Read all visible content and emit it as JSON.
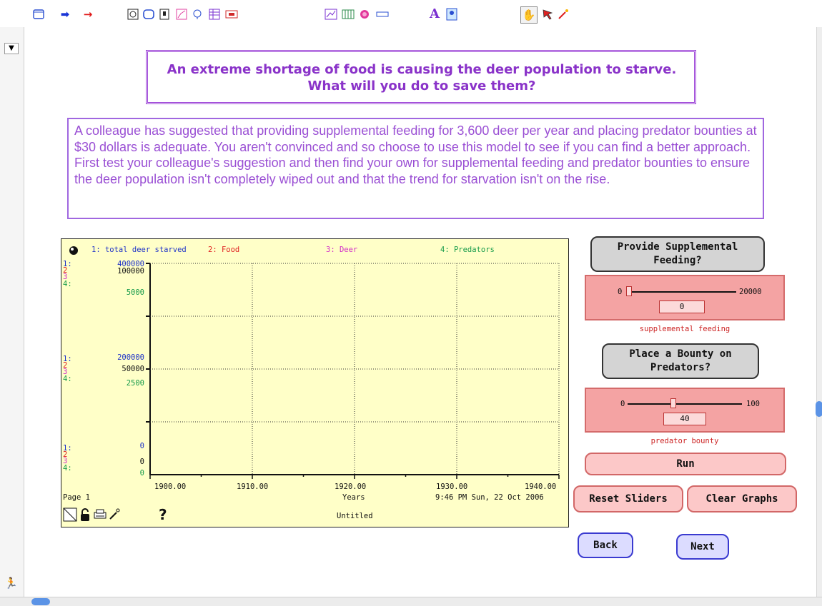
{
  "toolbar": {
    "icons": [
      "page-icon",
      "arrow-right-blue-icon",
      "arrow-right-red-icon",
      "loop-icon",
      "rounded-rect-icon",
      "switch-icon",
      "graph-pad-icon",
      "sector-icon",
      "table-icon",
      "numeric-display-icon",
      "line-graph-icon",
      "bar-icon",
      "meter-icon",
      "slider-icon",
      "text-icon",
      "picture-icon",
      "hand-icon",
      "pointer-icon",
      "magic-wand-icon"
    ]
  },
  "title": "An extreme shortage of food is causing the deer population to starve. What will you do to save them?",
  "description": "A colleague has suggested that providing supplemental feeding for 3,600 deer per year and placing predator bounties at $30 dollars is adequate. You aren't convinced and so choose to use this model to see if you can find a better approach. First test your colleague's suggestion and then find your own  for supplemental feeding and predator bounties to ensure the deer population isn't completely wiped out and that the trend for starvation isn't on the rise.",
  "graph": {
    "legend": [
      {
        "label": "1: total deer starved",
        "color": "#1f33c8"
      },
      {
        "label": "2: Food",
        "color": "#e02222"
      },
      {
        "label": "3: Deer",
        "color": "#d22cc9"
      },
      {
        "label": "4: Predators",
        "color": "#169b4a"
      }
    ],
    "axis_labels": {
      "top": {
        "s1": "400000",
        "s23": "100000",
        "s4": "5000"
      },
      "mid": {
        "s1": "200000",
        "s23": "50000",
        "s4": "2500"
      },
      "bottom": {
        "s1": "0",
        "s23": "0",
        "s4": "0"
      }
    },
    "series_markers": {
      "n1": "1:",
      "n2": "2",
      "n3": "3",
      "n4": "4:"
    },
    "x_ticks": [
      "1900.00",
      "1910.00",
      "1920.00",
      "1930.00",
      "1940.00"
    ],
    "x_label": "Years",
    "page": "Page 1",
    "timestamp": "9:46 PM  Sun, 22 Oct 2006",
    "doc_title": "Untitled",
    "help": "?"
  },
  "chart_data": {
    "type": "line",
    "x": [],
    "xlim": [
      1900,
      1940
    ],
    "series": [
      {
        "name": "1: total deer starved",
        "values": [],
        "ylim": [
          0,
          400000
        ]
      },
      {
        "name": "2: Food",
        "values": [],
        "ylim": [
          0,
          100000
        ]
      },
      {
        "name": "3: Deer",
        "values": [],
        "ylim": [
          0,
          100000
        ]
      },
      {
        "name": "4: Predators",
        "values": [],
        "ylim": [
          0,
          5000
        ]
      }
    ],
    "xlabel": "Years",
    "grid": true
  },
  "feeding": {
    "button": "Provide Supplemental Feeding?",
    "min": "0",
    "max": "20000",
    "value": "0",
    "fraction": 0,
    "caption": "supplemental feeding"
  },
  "bounty": {
    "button": "Place a Bounty on Predators?",
    "min": "0",
    "max": "100",
    "value": "40",
    "fraction": 0.4,
    "caption": "predator bounty"
  },
  "actions": {
    "run": "Run",
    "reset": "Reset Sliders",
    "clear": "Clear Graphs",
    "back": "Back",
    "next": "Next"
  }
}
